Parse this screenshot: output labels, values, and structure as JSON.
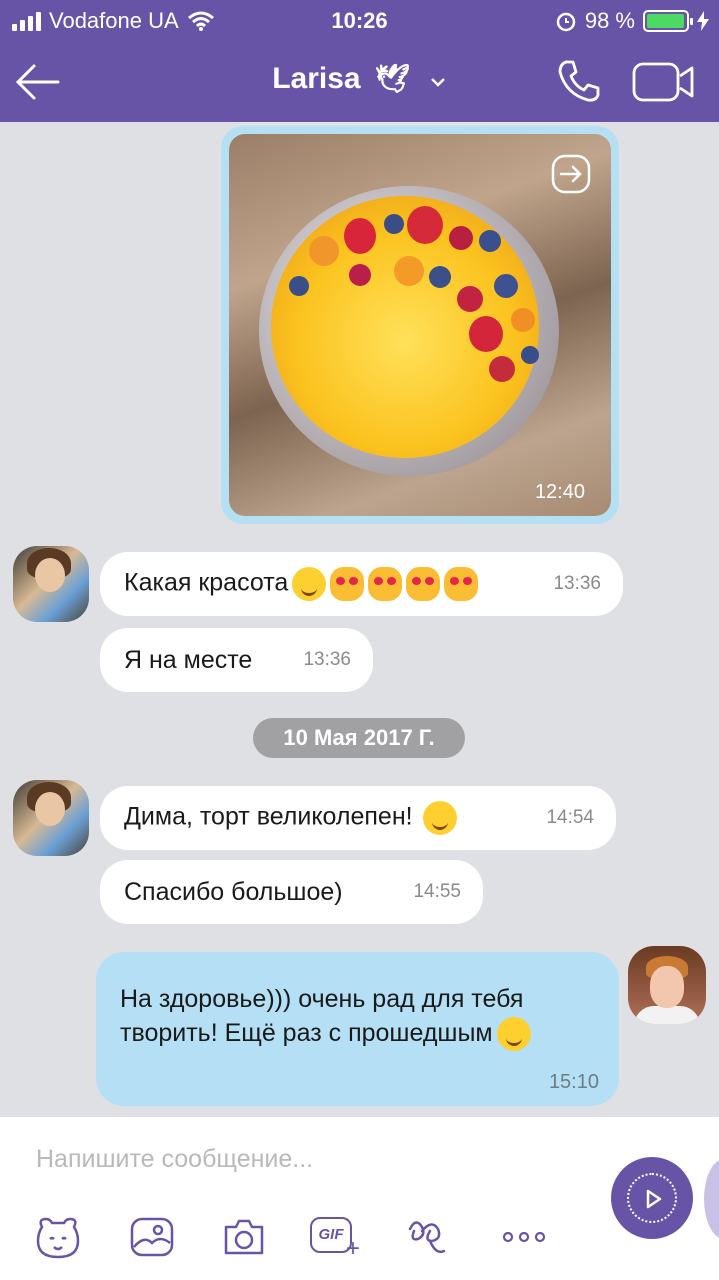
{
  "status_bar": {
    "carrier": "Vodafone UA",
    "time": "10:26",
    "battery": "98 %",
    "battery_level": 0.98
  },
  "header": {
    "contact_name": "Larisa",
    "contact_emoji": "🕊",
    "icons": [
      "back-arrow-icon",
      "chevron-down-icon",
      "phone-icon",
      "video-camera-icon"
    ]
  },
  "messages": {
    "photo": {
      "time": "12:40"
    },
    "incoming_1": {
      "text": "Какая красота",
      "time": "13:36"
    },
    "incoming_2": {
      "text": "Я на месте",
      "time": "13:36"
    },
    "date_separator": "10 Мая 2017 Г.",
    "incoming_3": {
      "text": "Дима, торт великолепен!",
      "time": "14:54"
    },
    "incoming_4": {
      "text": "Спасибо большое)",
      "time": "14:55"
    },
    "outgoing_1": {
      "text": "На здоровье))) очень рад для тебя творить! Ещё раз с прошедшым",
      "time": "15:10"
    }
  },
  "composer": {
    "placeholder": "Напишите сообщение...",
    "tools": [
      "sticker-bear-icon",
      "gallery-icon",
      "camera-icon",
      "gif-icon",
      "doodle-icon",
      "more-icon"
    ],
    "gif_label": "GIF"
  },
  "colors": {
    "header": "#6854a7",
    "background": "#dfe0e4",
    "outgoing_bubble": "#b4dff4",
    "incoming_bubble": "#ffffff",
    "date_pill": "#a1a1a3"
  }
}
